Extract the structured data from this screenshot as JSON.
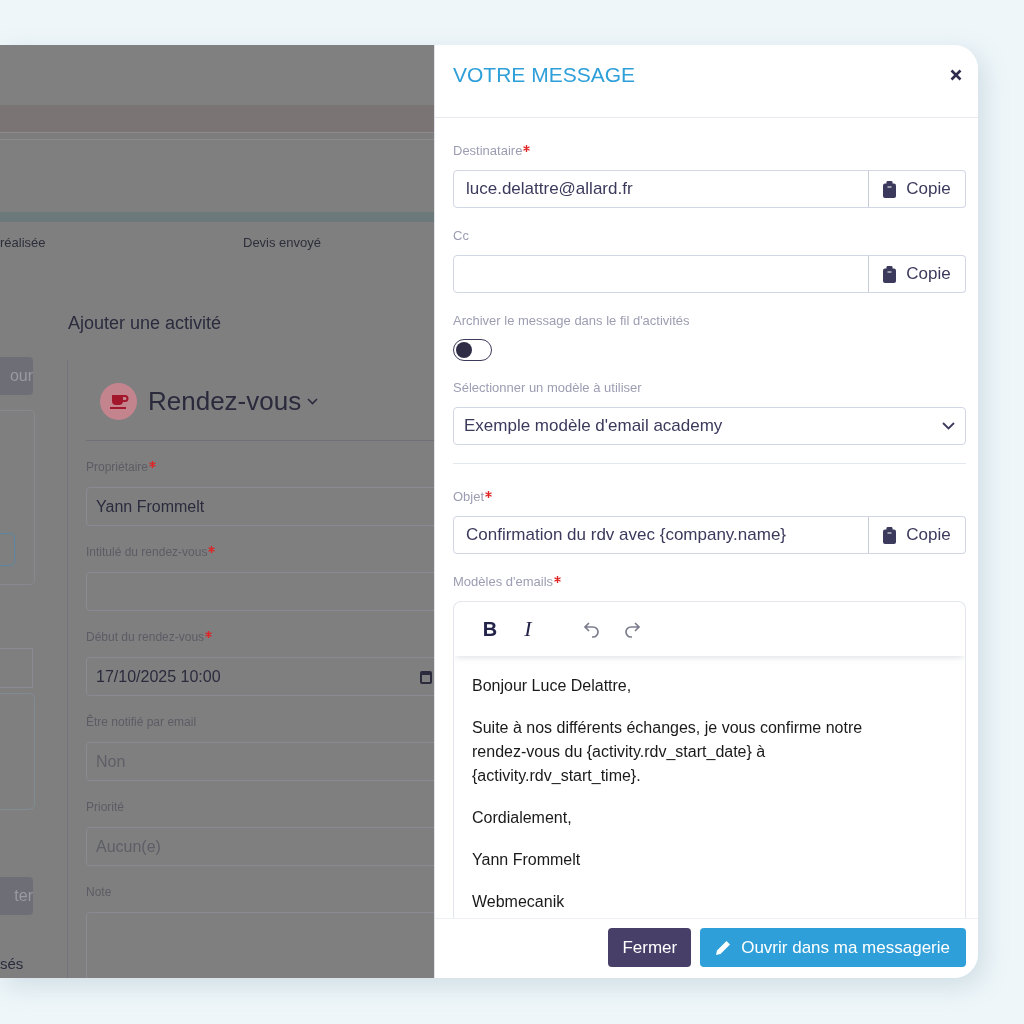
{
  "background": {
    "stages": [
      {
        "label": "réalisée"
      },
      {
        "label": "Devis envoyé"
      }
    ],
    "side_buttons": [
      {
        "label": "our"
      },
      {
        "label": "ter"
      }
    ],
    "side_text": "sés",
    "activity_form": {
      "heading": "Ajouter une activité",
      "type": "Rendez-vous",
      "fields": [
        {
          "label": "Propriétaire",
          "required": true,
          "kind": "text",
          "value": "Yann Frommelt"
        },
        {
          "label": "Intitulé du rendez-vous",
          "required": true,
          "kind": "text"
        },
        {
          "label": "Début du rendez-vous",
          "required": true,
          "kind": "datetime",
          "value": "17/10/2025 10:00"
        },
        {
          "label": "Être notifié par email",
          "required": false,
          "kind": "text",
          "placeholder": "Non"
        },
        {
          "label": "Priorité",
          "required": false,
          "kind": "text",
          "placeholder": "Aucun(e)"
        },
        {
          "label": "Note",
          "required": false,
          "kind": "textarea"
        }
      ]
    }
  },
  "modal": {
    "title": "VOTRE MESSAGE",
    "settings": [
      {
        "kind": "copy",
        "label": "Destinataire",
        "required": true,
        "value": "luce.delattre@allard.fr",
        "button": "Copie"
      },
      {
        "kind": "copy",
        "label": "Cc",
        "required": false,
        "button": "Copie"
      },
      {
        "kind": "toggle",
        "label": "Archiver le message dans le fil d'activités",
        "required": false,
        "on": false
      },
      {
        "kind": "select",
        "label": "Sélectionner un modèle à utiliser",
        "required": false,
        "value": "Exemple modèle d'email academy"
      }
    ],
    "subject": {
      "label": "Objet",
      "required": true,
      "value": "Confirmation du rdv avec {company.name}",
      "button": "Copie"
    },
    "editor": {
      "label": "Modèles d'emails",
      "required": true,
      "toolbar": [
        {
          "kind": "bold",
          "label": "B"
        },
        {
          "kind": "italic",
          "label": "I"
        },
        {
          "kind": "undo"
        },
        {
          "kind": "redo"
        }
      ],
      "paragraphs": [
        "Bonjour Luce Delattre,",
        "Suite à nos différents échanges, je vous confirme notre rendez-vous du {activity.rdv_start_date} à {activity.rdv_start_time}.",
        "Cordialement,",
        "Yann Frommelt",
        "Webmecanik"
      ]
    },
    "footer_buttons": [
      {
        "kind": "secondary",
        "label": "Fermer"
      },
      {
        "kind": "primary",
        "label": "Ouvrir dans ma messagerie"
      }
    ]
  }
}
